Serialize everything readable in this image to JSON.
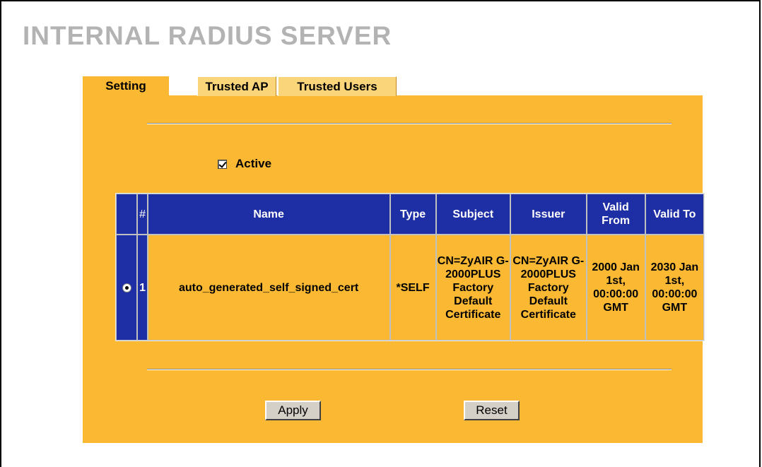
{
  "page": {
    "title": "INTERNAL RADIUS SERVER"
  },
  "tabs": [
    {
      "label": "Setting",
      "selected": true
    },
    {
      "label": "Trusted AP",
      "selected": false
    },
    {
      "label": "Trusted Users",
      "selected": false
    }
  ],
  "active": {
    "label": "Active",
    "checked": true
  },
  "table": {
    "columns": [
      "#",
      "Name",
      "Type",
      "Subject",
      "Issuer",
      "Valid From",
      "Valid To"
    ],
    "rows": [
      {
        "selected": true,
        "num": "1",
        "name": "auto_generated_self_signed_cert",
        "type": "*SELF",
        "subject": "CN=ZyAIR G-2000PLUS Factory Default Certificate",
        "issuer": "CN=ZyAIR G-2000PLUS Factory Default Certificate",
        "valid_from": "2000 Jan 1st, 00:00:00 GMT",
        "valid_to": "2030 Jan 1st, 00:00:00 GMT"
      }
    ]
  },
  "buttons": {
    "apply": "Apply",
    "reset": "Reset"
  },
  "colors": {
    "panel": "#fbb833",
    "header": "#1e2ea4",
    "title": "#b3b3b3"
  }
}
